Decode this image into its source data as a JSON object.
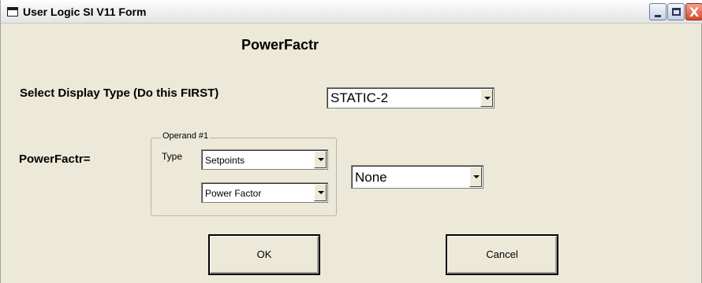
{
  "window": {
    "title": "User Logic SI V11 Form",
    "controls": {
      "minimize": "minimize",
      "maximize": "maximize",
      "close": "X"
    }
  },
  "form": {
    "heading": "PowerFactr",
    "display_type_label": "Select Display Type (Do this FIRST)",
    "display_type_value": "STATIC-2",
    "expression_label": "PowerFactr=",
    "operand_group_label": "Operand #1",
    "type_label": "Type",
    "type_value": "Setpoints",
    "operand_value": "Power Factor",
    "operator_value": "None"
  },
  "buttons": {
    "ok_label": "OK",
    "cancel_label": "Cancel"
  }
}
